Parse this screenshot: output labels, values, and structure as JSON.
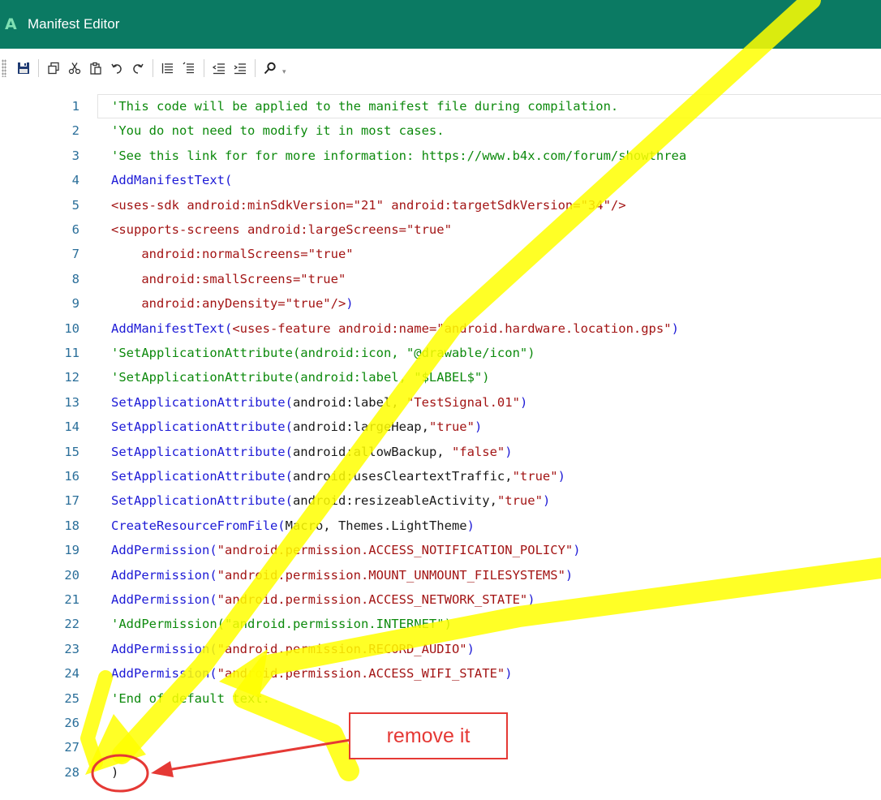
{
  "window": {
    "app_icon": "A",
    "title": "Manifest Editor"
  },
  "toolbar": {
    "buttons": [
      {
        "name": "save-button",
        "icon": "save-icon"
      },
      {
        "name": "copy-button",
        "icon": "copy-icon"
      },
      {
        "name": "cut-button",
        "icon": "cut-icon"
      },
      {
        "name": "paste-button",
        "icon": "paste-icon"
      },
      {
        "name": "undo-button",
        "icon": "undo-icon"
      },
      {
        "name": "redo-button",
        "icon": "redo-icon"
      },
      {
        "name": "comment-button",
        "icon": "comment-icon"
      },
      {
        "name": "uncomment-button",
        "icon": "uncomment-icon"
      },
      {
        "name": "outdent-button",
        "icon": "outdent-icon"
      },
      {
        "name": "indent-button",
        "icon": "indent-icon"
      },
      {
        "name": "find-button",
        "icon": "search-icon"
      }
    ]
  },
  "editor": {
    "lines": [
      {
        "n": "1",
        "segs": [
          {
            "t": "'This code will be applied to the manifest file during compilation.",
            "c": "comment"
          }
        ]
      },
      {
        "n": "2",
        "segs": [
          {
            "t": "'You do not need to modify it in most cases.",
            "c": "comment"
          }
        ]
      },
      {
        "n": "3",
        "segs": [
          {
            "t": "'See this link for for more information: https://www.b4x.com/forum/showthrea",
            "c": "comment"
          }
        ]
      },
      {
        "n": "4",
        "segs": [
          {
            "t": "AddManifestText(",
            "c": "func"
          }
        ]
      },
      {
        "n": "5",
        "segs": [
          {
            "t": "<uses-sdk android:minSdkVersion=\"21\" android:targetSdkVersion=\"34\"/>",
            "c": "xml"
          }
        ]
      },
      {
        "n": "6",
        "segs": [
          {
            "t": "<supports-screens android:largeScreens=\"true\"",
            "c": "xml"
          }
        ]
      },
      {
        "n": "7",
        "segs": [
          {
            "t": "    android:normalScreens=\"true\"",
            "c": "xml"
          }
        ]
      },
      {
        "n": "8",
        "segs": [
          {
            "t": "    android:smallScreens=\"true\"",
            "c": "xml"
          }
        ]
      },
      {
        "n": "9",
        "segs": [
          {
            "t": "    android:anyDensity=\"true\"/>",
            "c": "xml"
          },
          {
            "t": ")",
            "c": "func"
          }
        ]
      },
      {
        "n": "10",
        "segs": [
          {
            "t": "AddManifestText(",
            "c": "func"
          },
          {
            "t": "<uses-feature android:name=\"android.hardware.location.gps\"",
            "c": "xml"
          },
          {
            "t": ")",
            "c": "func"
          }
        ]
      },
      {
        "n": "11",
        "segs": [
          {
            "t": "'SetApplicationAttribute(android:icon, \"@drawable/icon\")",
            "c": "comment"
          }
        ]
      },
      {
        "n": "12",
        "segs": [
          {
            "t": "'SetApplicationAttribute(android:label, \"$LABEL$\")",
            "c": "comment"
          }
        ]
      },
      {
        "n": "13",
        "segs": [
          {
            "t": "SetApplicationAttribute(",
            "c": "func"
          },
          {
            "t": "android:label, ",
            "c": "plain"
          },
          {
            "t": "\"TestSignal.01\"",
            "c": "str"
          },
          {
            "t": ")",
            "c": "func"
          }
        ]
      },
      {
        "n": "14",
        "segs": [
          {
            "t": "SetApplicationAttribute(",
            "c": "func"
          },
          {
            "t": "android:largeHeap,",
            "c": "plain"
          },
          {
            "t": "\"true\"",
            "c": "str"
          },
          {
            "t": ")",
            "c": "func"
          }
        ]
      },
      {
        "n": "15",
        "segs": [
          {
            "t": "SetApplicationAttribute(",
            "c": "func"
          },
          {
            "t": "android:allowBackup, ",
            "c": "plain"
          },
          {
            "t": "\"false\"",
            "c": "str"
          },
          {
            "t": ")",
            "c": "func"
          }
        ]
      },
      {
        "n": "16",
        "segs": [
          {
            "t": "SetApplicationAttribute(",
            "c": "func"
          },
          {
            "t": "android:usesCleartextTraffic,",
            "c": "plain"
          },
          {
            "t": "\"true\"",
            "c": "str"
          },
          {
            "t": ")",
            "c": "func"
          }
        ]
      },
      {
        "n": "17",
        "segs": [
          {
            "t": "SetApplicationAttribute(",
            "c": "func"
          },
          {
            "t": "android:resizeableActivity,",
            "c": "plain"
          },
          {
            "t": "\"true\"",
            "c": "str"
          },
          {
            "t": ")",
            "c": "func"
          }
        ]
      },
      {
        "n": "18",
        "segs": [
          {
            "t": "CreateResourceFromFile(",
            "c": "func"
          },
          {
            "t": "Macro, Themes.LightTheme",
            "c": "plain"
          },
          {
            "t": ")",
            "c": "func"
          }
        ]
      },
      {
        "n": "19",
        "segs": [
          {
            "t": "AddPermission(",
            "c": "func"
          },
          {
            "t": "\"android.permission.ACCESS_NOTIFICATION_POLICY\"",
            "c": "str"
          },
          {
            "t": ")",
            "c": "func"
          }
        ]
      },
      {
        "n": "20",
        "segs": [
          {
            "t": "AddPermission(",
            "c": "func"
          },
          {
            "t": "\"android.permission.MOUNT_UNMOUNT_FILESYSTEMS\"",
            "c": "str"
          },
          {
            "t": ")",
            "c": "func"
          }
        ]
      },
      {
        "n": "21",
        "segs": [
          {
            "t": "AddPermission(",
            "c": "func"
          },
          {
            "t": "\"android.permission.ACCESS_NETWORK_STATE\"",
            "c": "str"
          },
          {
            "t": ")",
            "c": "func"
          }
        ]
      },
      {
        "n": "22",
        "segs": [
          {
            "t": "'AddPermission(\"android.permission.INTERNET\")",
            "c": "comment"
          }
        ]
      },
      {
        "n": "23",
        "segs": [
          {
            "t": "AddPermission(",
            "c": "func"
          },
          {
            "t": "\"android.permission.RECORD_AUDIO\"",
            "c": "str"
          },
          {
            "t": ")",
            "c": "func"
          }
        ]
      },
      {
        "n": "24",
        "segs": [
          {
            "t": "AddPermission(",
            "c": "func"
          },
          {
            "t": "\"android.permission.ACCESS_WIFI_STATE\"",
            "c": "str"
          },
          {
            "t": ")",
            "c": "func"
          }
        ]
      },
      {
        "n": "25",
        "segs": [
          {
            "t": "'End of default text.",
            "c": "comment"
          }
        ]
      },
      {
        "n": "26",
        "segs": []
      },
      {
        "n": "27",
        "segs": []
      },
      {
        "n": "28",
        "segs": [
          {
            "t": ")",
            "c": "plain"
          }
        ]
      }
    ]
  },
  "annotation": {
    "label": "remove it",
    "color": "#e53935"
  },
  "colors": {
    "titlebar": "#0b7a63",
    "highlighter": "#ffff00",
    "comment": "#0d8a0d",
    "function": "#1d1ad6",
    "string": "#a31515"
  }
}
